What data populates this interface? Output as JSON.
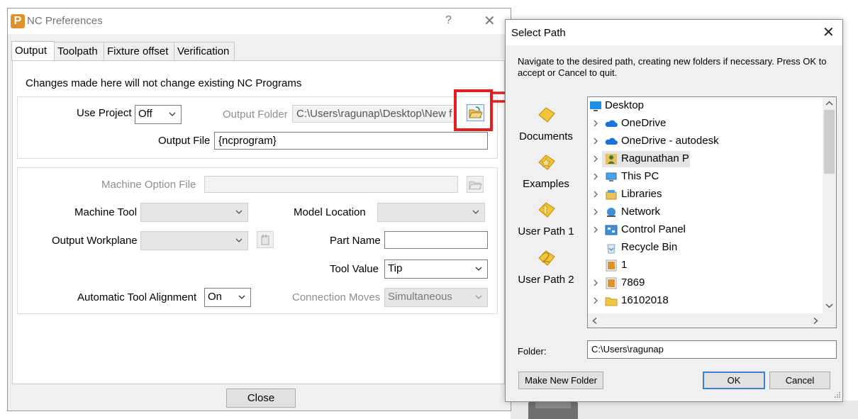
{
  "nc": {
    "title": "NC Preferences",
    "help": "?",
    "close_glyph": "✕",
    "app_icon_letter": "P",
    "tabs": [
      "Output",
      "Toolpath",
      "Fixture offset",
      "Verification"
    ],
    "notice": "Changes made here will not change existing NC Programs",
    "use_project_label": "Use Project",
    "use_project_value": "Off",
    "output_folder_label": "Output Folder",
    "output_folder_value": "C:\\Users\\ragunap\\Desktop\\New f",
    "output_file_label": "Output File",
    "output_file_value": "{ncprogram}",
    "machine_option_label": "Machine Option File",
    "machine_option_value": "",
    "machine_tool_label": "Machine Tool",
    "machine_tool_value": "",
    "model_location_label": "Model Location",
    "model_location_value": "",
    "output_workplane_label": "Output Workplane",
    "output_workplane_value": "",
    "part_name_label": "Part Name",
    "part_name_value": "",
    "tool_value_label": "Tool Value",
    "tool_value_value": "Tip",
    "auto_tool_label": "Automatic Tool Alignment",
    "auto_tool_value": "On",
    "connection_moves_label": "Connection Moves",
    "connection_moves_value": "Simultaneous",
    "close_button": "Close"
  },
  "select_path": {
    "title": "Select Path",
    "close_glyph": "✕",
    "message": "Navigate to the desired path, creating new folders if necessary. Press OK to accept or Cancel to quit.",
    "places": [
      "Documents",
      "Examples",
      "User Path 1",
      "User Path 2"
    ],
    "tree": [
      {
        "label": "Desktop",
        "icon": "desktop-icon"
      },
      {
        "label": "OneDrive",
        "icon": "cloud-icon"
      },
      {
        "label": "OneDrive - autodesk",
        "icon": "cloud-icon"
      },
      {
        "label": "Ragunathan P",
        "icon": "user-icon"
      },
      {
        "label": "This PC",
        "icon": "computer-icon"
      },
      {
        "label": "Libraries",
        "icon": "libraries-icon"
      },
      {
        "label": "Network",
        "icon": "network-icon"
      },
      {
        "label": "Control Panel",
        "icon": "control-panel-icon"
      },
      {
        "label": "Recycle Bin",
        "icon": "recycle-bin-icon"
      },
      {
        "label": "1",
        "icon": "app-file-icon"
      },
      {
        "label": "7869",
        "icon": "app-file-icon"
      },
      {
        "label": "16102018",
        "icon": "folder-icon"
      }
    ],
    "folder_label": "Folder:",
    "folder_value": "C:\\Users\\ragunap",
    "make_new_folder": "Make New Folder",
    "ok": "OK",
    "cancel": "Cancel"
  },
  "colors": {
    "highlight_box": "#e02020",
    "arrow": "#e02020",
    "accent": "#3c7fd1",
    "app_icon": "#e0912b"
  }
}
